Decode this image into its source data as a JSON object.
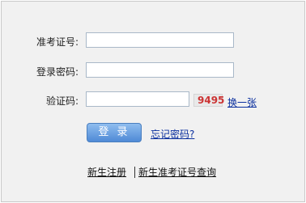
{
  "form": {
    "exam_id_label": "准考证号:",
    "exam_id_value": "",
    "password_label": "登录密码:",
    "password_value": "",
    "captcha_label": "验证码:",
    "captcha_value": "",
    "captcha_image_text": "9495",
    "refresh_captcha_link": "换一张",
    "login_button": "登 录",
    "forgot_password_link": "忘记密码?"
  },
  "footer": {
    "register_link": "新生注册",
    "lookup_link": "新生准考证号查询"
  }
}
